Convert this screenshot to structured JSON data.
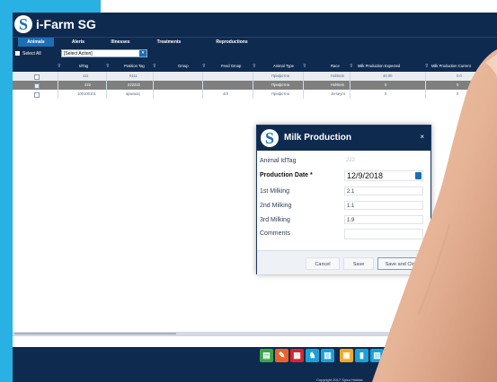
{
  "app": {
    "title": "i-Farm SG",
    "logo_letter": "S"
  },
  "tabs": [
    {
      "label": "Animals",
      "active": true
    },
    {
      "label": "Alerts"
    },
    {
      "label": "Illnesses"
    },
    {
      "label": "Treatments"
    },
    {
      "label": "Reproductions"
    }
  ],
  "toolbar": {
    "select_all_label": "Select All",
    "action_select_value": "[Select Action]"
  },
  "columns": [
    "IdTag",
    "Position Tag",
    "Group",
    "Feed Group",
    "Animal Type",
    "Race",
    "Milk Production Expected",
    "Milk Production Current"
  ],
  "rows": [
    {
      "cells": [
        "111",
        "0111",
        "",
        "",
        "Прифотна",
        "Holstein",
        "40.00",
        "0.0"
      ],
      "state": "alt"
    },
    {
      "cells": [
        "222",
        "222222",
        "",
        "",
        "Прифотна",
        "Holstein",
        "0",
        "0"
      ],
      "state": "selected"
    },
    {
      "cells": [
        "100100101",
        "ajawaoq",
        "",
        "4rlt",
        "Прифотна",
        "Jerseynt",
        "0",
        "0"
      ],
      "state": "normal"
    }
  ],
  "modal": {
    "title": "Milk Production",
    "close_icon": "×",
    "fields": {
      "animal_id_label": "Animal IdTag",
      "animal_id_value": "222",
      "production_date_label": "Production Date *",
      "production_date_value": "12/9/2018",
      "milking1_label": "1st Milking",
      "milking1_value": "2.1",
      "milking2_label": "2nd Milking",
      "milking2_value": "1.1",
      "milking3_label": "3rd Milking",
      "milking3_value": "1.9",
      "comments_label": "Comments",
      "comments_value": ""
    },
    "buttons": {
      "cancel": "Cancel",
      "save": "Save",
      "save_close": "Save and Close"
    }
  },
  "footer": {
    "copyright": "Copyright 2017 Sylco Holdas"
  },
  "quick_actions": [
    {
      "icon": "add-document-icon",
      "color": "#3aa64a"
    },
    {
      "icon": "pencil-icon",
      "color": "#e8632b"
    },
    {
      "icon": "delete-icon",
      "color": "#d2262e"
    },
    {
      "icon": "cow-icon",
      "color": "#1aa1d6"
    },
    {
      "icon": "chart-icon",
      "color": "#1aa1d6"
    },
    {
      "icon": "group-icon",
      "color": "#f3a91f"
    },
    {
      "icon": "lock-icon",
      "color": "#1aa1d6"
    },
    {
      "icon": "print-icon",
      "color": "#1aa1d6"
    }
  ],
  "colors": {
    "navy": "#0f2a4f",
    "accent": "#1c6fb5",
    "cyan": "#29b1e3",
    "selected_row": "#7f7f7f"
  }
}
